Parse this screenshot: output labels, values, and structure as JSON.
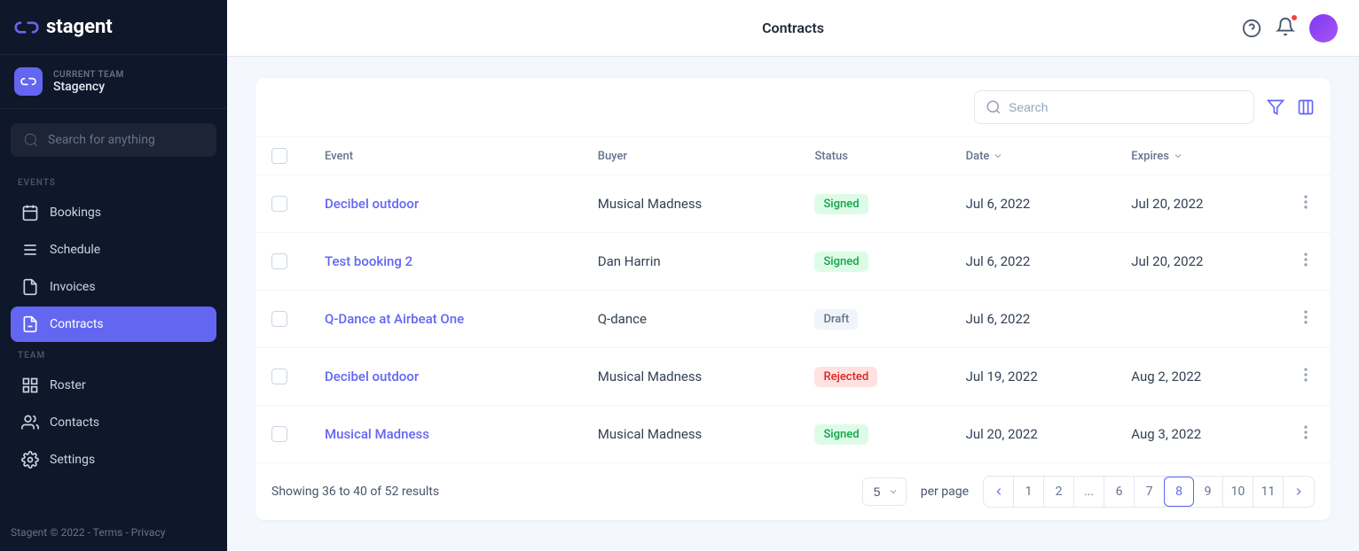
{
  "brand": "stagent",
  "team": {
    "label": "CURRENT TEAM",
    "name": "Stagency"
  },
  "sidebar_search_placeholder": "Search for anything",
  "sections": {
    "events_label": "EVENTS",
    "team_label": "TEAM"
  },
  "nav": {
    "bookings": "Bookings",
    "schedule": "Schedule",
    "invoices": "Invoices",
    "contracts": "Contracts",
    "roster": "Roster",
    "contacts": "Contacts",
    "settings": "Settings"
  },
  "footer": {
    "copyright": "Stagent © 2022",
    "terms": "Terms",
    "privacy": "Privacy",
    "sep": " - "
  },
  "header": {
    "title": "Contracts"
  },
  "search": {
    "placeholder": "Search"
  },
  "columns": {
    "event": "Event",
    "buyer": "Buyer",
    "status": "Status",
    "date": "Date",
    "expires": "Expires"
  },
  "rows": [
    {
      "event": "Decibel outdoor",
      "buyer": "Musical Madness",
      "status": "Signed",
      "status_class": "signed",
      "date": "Jul 6, 2022",
      "expires": "Jul 20, 2022"
    },
    {
      "event": "Test booking 2",
      "buyer": "Dan Harrin",
      "status": "Signed",
      "status_class": "signed",
      "date": "Jul 6, 2022",
      "expires": "Jul 20, 2022"
    },
    {
      "event": "Q-Dance at Airbeat One",
      "buyer": "Q-dance",
      "status": "Draft",
      "status_class": "draft",
      "date": "Jul 6, 2022",
      "expires": ""
    },
    {
      "event": "Decibel outdoor",
      "buyer": "Musical Madness",
      "status": "Rejected",
      "status_class": "rejected",
      "date": "Jul 19, 2022",
      "expires": "Aug 2, 2022"
    },
    {
      "event": "Musical Madness",
      "buyer": "Musical Madness",
      "status": "Signed",
      "status_class": "signed",
      "date": "Jul 20, 2022",
      "expires": "Aug 3, 2022"
    }
  ],
  "pagination": {
    "results_text": "Showing 36 to 40 of 52 results",
    "per_page": "5",
    "per_page_label": "per page",
    "pages": [
      "1",
      "2",
      "...",
      "6",
      "7",
      "8",
      "9",
      "10",
      "11"
    ],
    "current": "8"
  }
}
